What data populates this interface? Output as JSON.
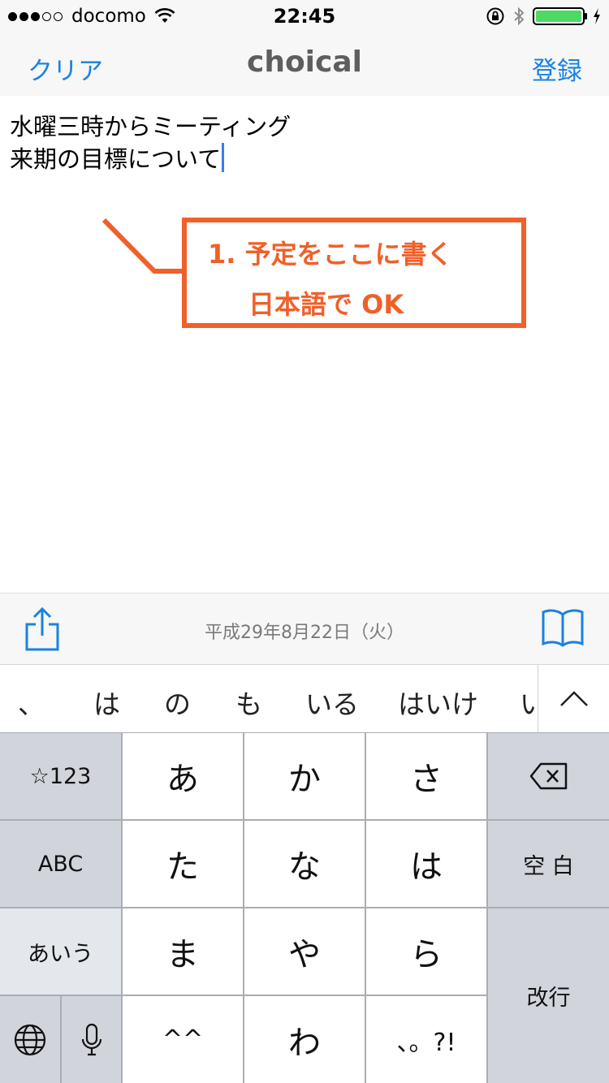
{
  "status_bar": {
    "carrier": "docomo",
    "time": "22:45",
    "signal_dots_filled": 3,
    "signal_dots_total": 5,
    "battery_color": "#4cd964"
  },
  "nav": {
    "left_label": "クリア",
    "title": "choical",
    "right_label": "登録"
  },
  "editor": {
    "lines": [
      "水曜三時からミーティング",
      "来期の目標について"
    ]
  },
  "annotation": {
    "line1": "1. 予定をここに書く",
    "line2": "日本語で OK",
    "color": "#f0602a"
  },
  "toolbar": {
    "date": "平成29年8月22日（火）",
    "share_icon": "share-icon",
    "book_icon": "book-icon"
  },
  "suggestions": [
    "、",
    "は",
    "の",
    "も",
    "いる",
    "はいけ",
    "い"
  ],
  "keyboard": {
    "row1": [
      "☆123",
      "あ",
      "か",
      "さ",
      ""
    ],
    "row2": [
      "ABC",
      "た",
      "な",
      "は",
      "空 白"
    ],
    "row3": [
      "あいう",
      "ま",
      "や",
      "ら"
    ],
    "row4": [
      "",
      "",
      "^^",
      "わ",
      "、。?!"
    ],
    "return_label": "改行"
  }
}
